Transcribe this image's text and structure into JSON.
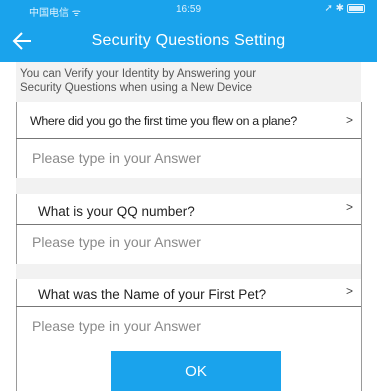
{
  "status": {
    "carrier": "中国电信 ᯤ",
    "time": "16:59",
    "icons": "➚ ✱"
  },
  "nav": {
    "back_icon": "arrow-left-icon",
    "title": "Security Questions Setting"
  },
  "info": {
    "line1": "You can Verify your Identity by Answering your",
    "line2": "Security Questions when using a New Device"
  },
  "questions": [
    {
      "label": "Where did you go the first time you flew on a plane?",
      "arrow": ">",
      "placeholder": "Please type in your Answer"
    },
    {
      "label": "What is your QQ number?",
      "arrow": ">",
      "placeholder": "Please type in your Answer"
    },
    {
      "label": "What was the Name of your First Pet?",
      "arrow": ">",
      "placeholder": "Please type in your Answer"
    }
  ],
  "ok_label": "OK",
  "colors": {
    "accent": "#1aa3ec",
    "section_gap": "#f2f2f2"
  }
}
